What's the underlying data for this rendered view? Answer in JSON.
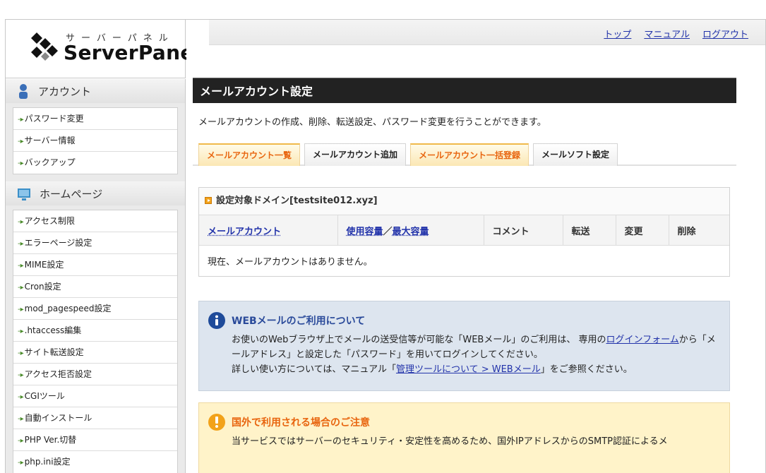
{
  "header": {
    "logo_kana": "サーバーパネル",
    "logo_text": "ServerPanel",
    "links": [
      "トップ",
      "マニュアル",
      "ログアウト"
    ]
  },
  "sidebar": {
    "sections": [
      {
        "title": "アカウント",
        "icon": "person-icon",
        "items": [
          "パスワード変更",
          "サーバー情報",
          "バックアップ"
        ]
      },
      {
        "title": "ホームページ",
        "icon": "monitor-icon",
        "items": [
          "アクセス制限",
          "エラーページ設定",
          "MIME設定",
          "Cron設定",
          "mod_pagespeed設定",
          ".htaccess編集",
          "サイト転送設定",
          "アクセス拒否設定",
          "CGIツール",
          "自動インストール",
          "PHP Ver.切替",
          "php.ini設定"
        ]
      }
    ]
  },
  "main": {
    "title": "メールアカウント設定",
    "description": "メールアカウントの作成、削除、転送設定、パスワード変更を行うことができます。",
    "tabs": [
      "メールアカウント一覧",
      "メールアカウント追加",
      "メールアカウント一括登録",
      "メールソフト設定"
    ],
    "panel_title": "設定対象ドメイン[testsite012.xyz]",
    "table": {
      "col_account": "メールアカウント",
      "col_used": "使用容量",
      "col_sep": "／",
      "col_max": "最大容量",
      "col_comment": "コメント",
      "col_forward": "転送",
      "col_change": "変更",
      "col_delete": "削除",
      "empty_message": "現在、メールアカウントはありません。"
    },
    "web_notice": {
      "title": "WEBメールのご利用について",
      "line1_pre": "お使いのWebブラウザ上でメールの送受信等が可能な「WEBメール」のご利用は、 専用の",
      "line1_link": "ログインフォーム",
      "line1_post": "から「メールアドレス」と設定した「パスワード」を用いてログインしてください。",
      "line2_pre": "詳しい使い方については、マニュアル「",
      "line2_link": "管理ツールについて > WEBメール",
      "line2_post": "」をご参照ください。"
    },
    "foreign_notice": {
      "title": "国外で利用される場合のご注意",
      "body": "当サービスではサーバーのセキュリティ・安定性を高めるため、国外IPアドレスからのSMTP認証によるメ"
    }
  }
}
